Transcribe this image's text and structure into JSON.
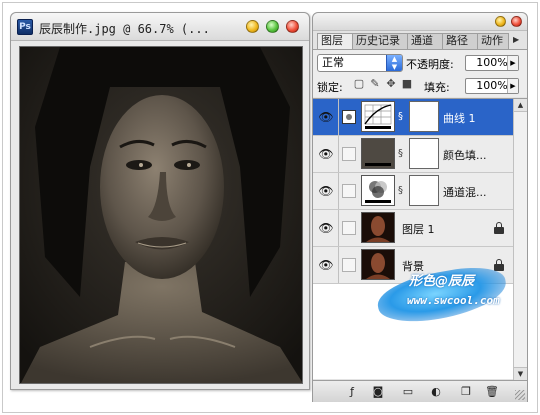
{
  "document": {
    "title": "辰辰制作.jpg @ 66.7% (...",
    "app_icon_label": "Ps"
  },
  "panel": {
    "tabs": [
      "图层",
      "历史记录",
      "通道",
      "路径",
      "动作"
    ],
    "active_tab": "图层",
    "blend_mode": "正常",
    "opacity_label": "不透明度:",
    "opacity_value": "100%",
    "lock_label": "锁定:",
    "fill_label": "填充:",
    "fill_value": "100%",
    "layers": [
      {
        "name": "曲线 1",
        "type": "curves adjustment",
        "selected": true,
        "has_mask": true,
        "locked": false
      },
      {
        "name": "颜色填...",
        "type": "solid color fill",
        "selected": false,
        "has_mask": true,
        "locked": false
      },
      {
        "name": "通道混...",
        "type": "channel mixer adjustment",
        "selected": false,
        "has_mask": true,
        "locked": false
      },
      {
        "name": "图层 1",
        "type": "pixel layer",
        "selected": false,
        "has_mask": false,
        "locked": true
      },
      {
        "name": "背景",
        "type": "background",
        "selected": false,
        "has_mask": false,
        "locked": true
      }
    ],
    "bottom_icons": [
      "link-layers-icon",
      "layer-style-icon",
      "layer-mask-icon",
      "new-group-icon",
      "adjustment-layer-icon",
      "new-layer-icon",
      "trash-icon"
    ]
  },
  "watermark": {
    "title": "形色@辰辰",
    "url": "www.swcool.com"
  },
  "colors": {
    "selection": "#2a64c8",
    "panel_bg": "#e3e3e3",
    "fill_layer_color": "#4e4942"
  }
}
